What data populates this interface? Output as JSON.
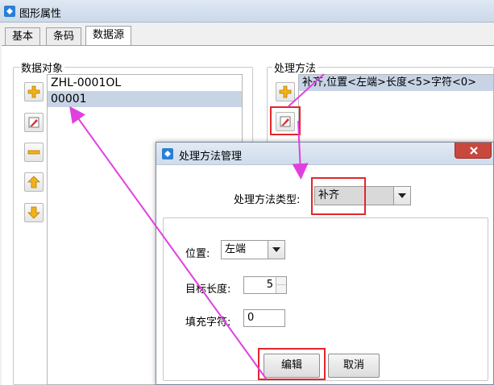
{
  "window": {
    "title": "图形属性"
  },
  "tabs": [
    {
      "label": "基本",
      "active": false
    },
    {
      "label": "条码",
      "active": false
    },
    {
      "label": "数据源",
      "active": true
    }
  ],
  "data_objects": {
    "title": "数据对象",
    "items": [
      {
        "label": "ZHL-0001OL",
        "selected": false
      },
      {
        "label": "00001",
        "selected": true
      }
    ]
  },
  "processing": {
    "title": "处理方法",
    "items": [
      {
        "label": "补齐,位置<左端>长度<5>字符<0>",
        "selected": true
      }
    ]
  },
  "dialog": {
    "title": "处理方法管理",
    "type_label": "处理方法类型:",
    "type_value": "补齐",
    "position_label": "位置:",
    "position_value": "左端",
    "length_label": "目标长度:",
    "length_value": "5",
    "fill_label": "填充字符:",
    "fill_value": "0",
    "edit_button": "编辑",
    "cancel_button": "取消"
  },
  "colors": {
    "highlight": "#e3262c",
    "annotation_arrow": "#e040e0",
    "selection": "#c7d4e6"
  },
  "icons": [
    "app-icon",
    "add-icon",
    "edit-icon",
    "remove-icon",
    "move-up-icon",
    "move-down-icon",
    "close-icon"
  ]
}
